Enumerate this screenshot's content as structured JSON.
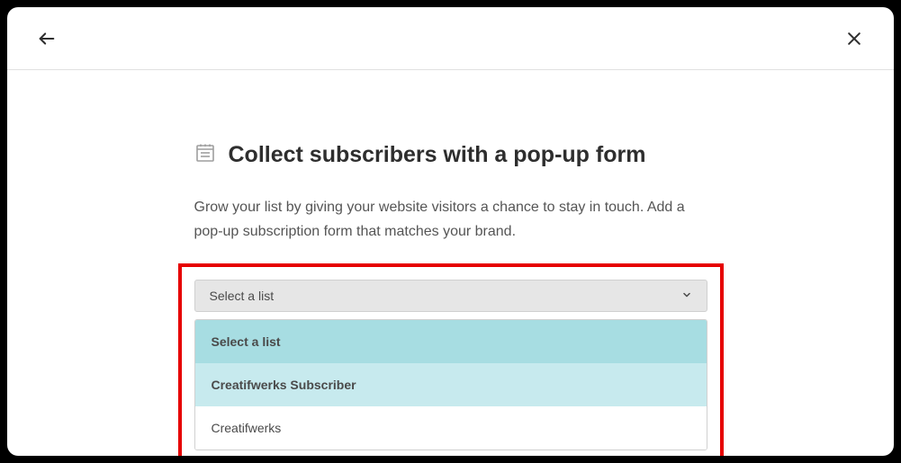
{
  "title": "Collect subscribers with a pop-up form",
  "description": "Grow your list by giving your website visitors a chance to stay in touch. Add a pop-up subscription form that matches your brand.",
  "select": {
    "label": "Select a list",
    "options": {
      "placeholder": "Select a list",
      "opt1": "Creatifwerks Subscriber",
      "opt2": "Creatifwerks"
    }
  }
}
